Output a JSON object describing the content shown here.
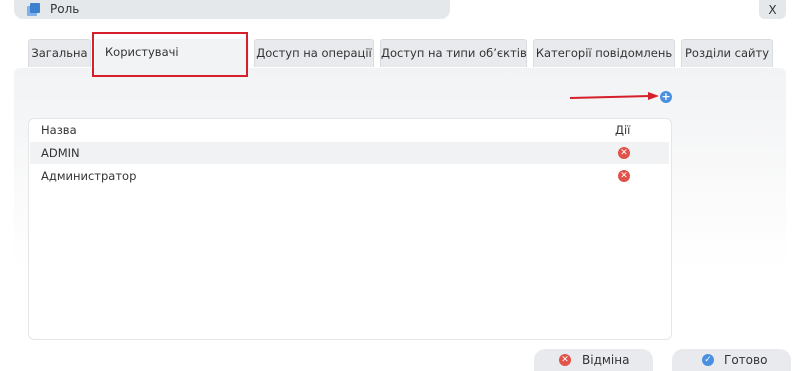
{
  "window": {
    "title": "Роль",
    "close_label": "X",
    "title_icon": "window-stack-icon"
  },
  "tabs": [
    {
      "label": "Загальна",
      "active": false
    },
    {
      "label": "Користувачі",
      "active": true
    },
    {
      "label": "Доступ на операції",
      "active": false
    },
    {
      "label": "Доступ на типи об’єктів",
      "active": false
    },
    {
      "label": "Категорії повідомлень",
      "active": false
    },
    {
      "label": "Розділи сайту",
      "active": false
    }
  ],
  "toolbar": {
    "add_icon": "add-circle-icon"
  },
  "grid": {
    "columns": {
      "name": "Назва",
      "actions": "Дії"
    },
    "rows": [
      {
        "name": "ADMIN"
      },
      {
        "name": "Администратор"
      }
    ]
  },
  "footer": {
    "cancel_label": "Відміна",
    "done_label": "Готово"
  },
  "colors": {
    "highlight": "#d51f2a",
    "accent": "#4a90e2",
    "delete": "#e0524a"
  }
}
